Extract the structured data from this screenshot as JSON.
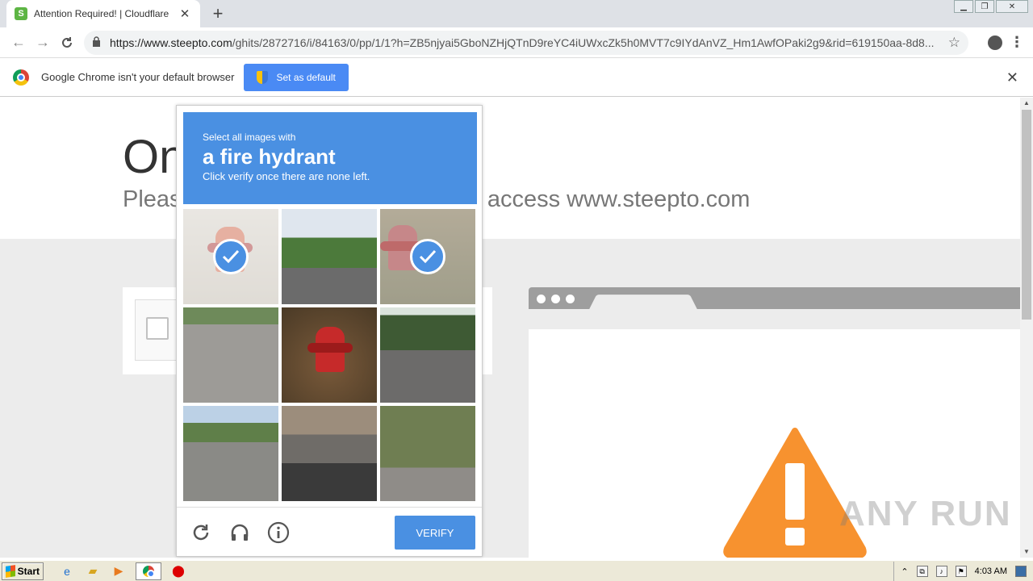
{
  "browser": {
    "tab_title": "Attention Required! | Cloudflare",
    "tab_favicon": "S",
    "url_host": "https://www.steepto.com",
    "url_path": "/ghits/2872716/i/84163/0/pp/1/1?h=ZB5njyai5GboNZHjQTnD9reYC4iUWxcZk5h0MVT7c9IYdAnVZ_Hm1AwfOPaki2g9&rid=619150aa-8d8...",
    "infobar_text": "Google Chrome isn't your default browser",
    "set_default_label": "Set as default"
  },
  "page": {
    "headline": "On",
    "subline": "Pleas",
    "subline_tail": "ck to access www.steepto.com"
  },
  "captcha": {
    "instruction_small": "Select all images with",
    "instruction_target": "a fire hydrant",
    "instruction_hint": "Click verify once there are none left.",
    "tiles": [
      {
        "subject": "fire hydrant",
        "selected": true
      },
      {
        "subject": "street",
        "selected": false
      },
      {
        "subject": "fire hydrant",
        "selected": true
      },
      {
        "subject": "road with car",
        "selected": false
      },
      {
        "subject": "fire hydrant",
        "selected": false
      },
      {
        "subject": "road",
        "selected": false
      },
      {
        "subject": "road with car",
        "selected": false
      },
      {
        "subject": "parked cars",
        "selected": false
      },
      {
        "subject": "bushes",
        "selected": false
      }
    ],
    "verify_label": "VERIFY"
  },
  "watermark": "ANY RUN",
  "taskbar": {
    "start_label": "Start",
    "clock": "4:03 AM"
  },
  "colors": {
    "captcha_blue": "#4a90e2",
    "warning_orange": "#f7922f",
    "chrome_button_blue": "#4a8af4"
  }
}
